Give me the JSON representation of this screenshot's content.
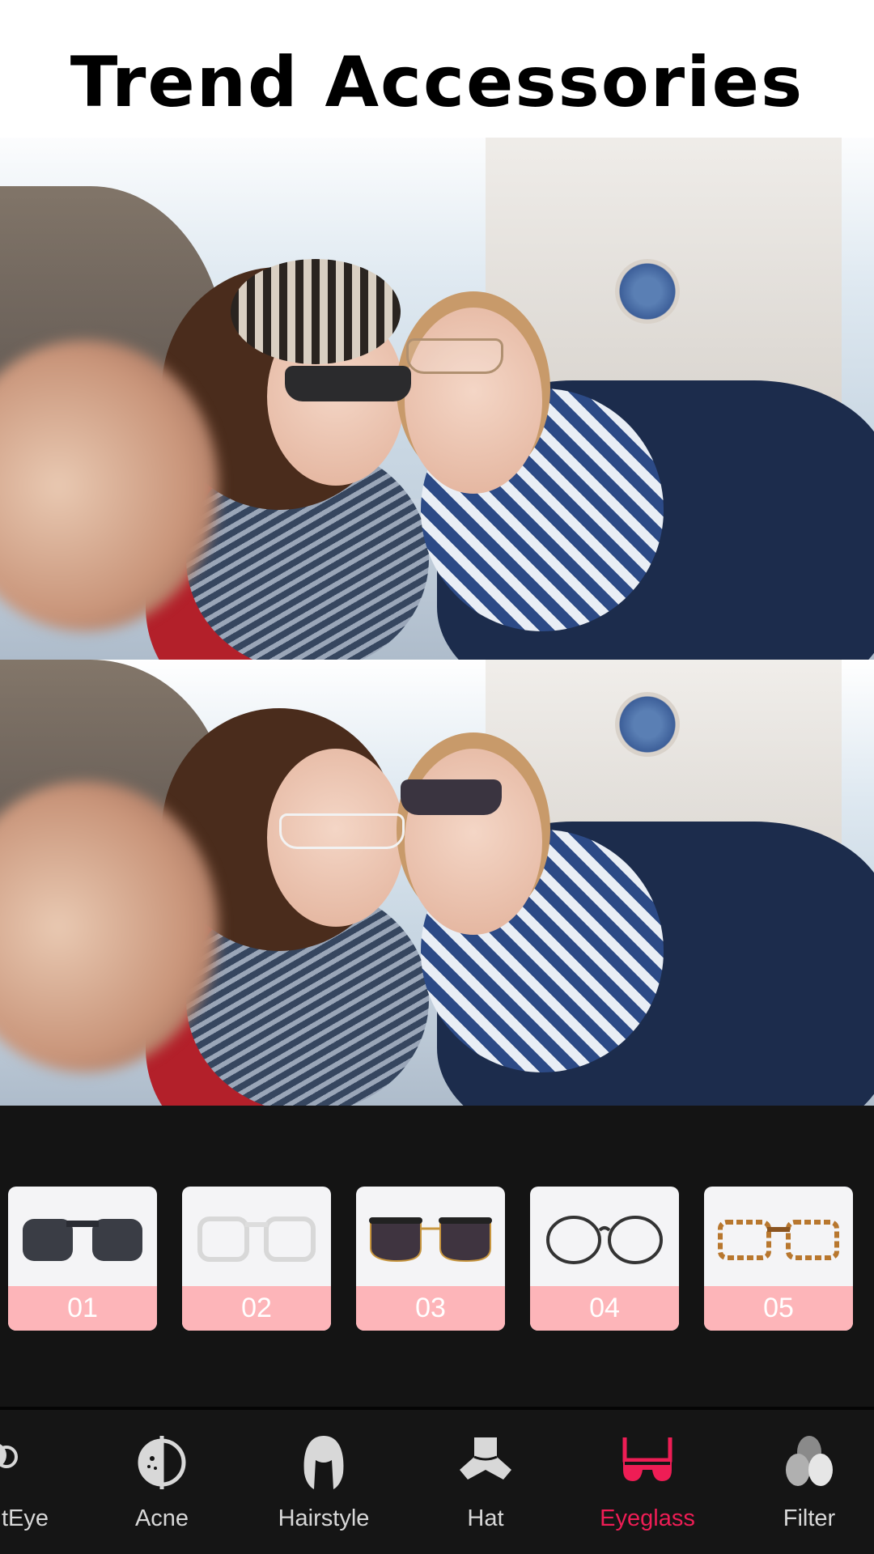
{
  "title": "Trend Accessories",
  "accent_color": "#ee1d55",
  "styles": [
    {
      "label": "01",
      "kind": "black-square-sunglasses"
    },
    {
      "label": "02",
      "kind": "clear-frame-glasses"
    },
    {
      "label": "03",
      "kind": "dark-gold-sunglasses"
    },
    {
      "label": "04",
      "kind": "round-black-glasses"
    },
    {
      "label": "05",
      "kind": "tortoise-glasses"
    }
  ],
  "nav": [
    {
      "label": "tEye",
      "icon": "bright-eye-icon"
    },
    {
      "label": "Acne",
      "icon": "acne-icon"
    },
    {
      "label": "Hairstyle",
      "icon": "hairstyle-icon"
    },
    {
      "label": "Hat",
      "icon": "hat-icon"
    },
    {
      "label": "Eyeglass",
      "icon": "eyeglass-icon",
      "active": true
    },
    {
      "label": "Filter",
      "icon": "filter-icon"
    }
  ]
}
